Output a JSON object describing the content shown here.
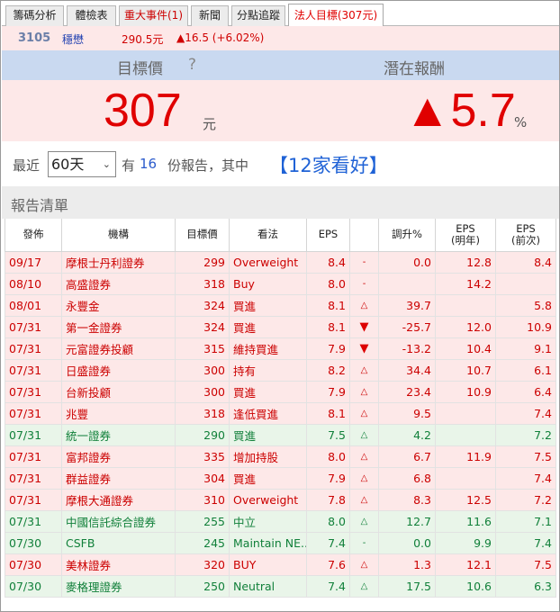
{
  "tabs": [
    {
      "label": "籌碼分析"
    },
    {
      "label": "體檢表"
    },
    {
      "label": "重大事件(1)"
    },
    {
      "label": "新聞"
    },
    {
      "label": "分點追蹤"
    },
    {
      "label": "法人目標(307元)"
    }
  ],
  "stock": {
    "code": "3105",
    "name": "穩懋",
    "price": "290.5元",
    "change": "▲16.5 (+6.02%)"
  },
  "banner": {
    "target_label": "目標價",
    "help_icon": "?",
    "return_label": "潛在報酬"
  },
  "target": {
    "value": "307",
    "unit": "元",
    "potential": "▲5.7",
    "potential_unit": "%"
  },
  "filter": {
    "prefix": "最近",
    "period": "60天",
    "has": "有",
    "count": "16",
    "suffix": "份報告，其中",
    "highlight": "【12家看好】"
  },
  "list": {
    "title": "報告清單",
    "headers": [
      "發佈",
      "機構",
      "目標價",
      "看法",
      "EPS",
      "",
      "調升%",
      "EPS\n(明年)",
      "EPS\n(前次)"
    ],
    "rows": [
      {
        "tone": "r",
        "date": "09/17",
        "org": "摩根士丹利證券",
        "target": "299",
        "view": "Overweight",
        "eps": "8.4",
        "arrow": "-",
        "chg": "0.0",
        "eps_next": "12.8",
        "eps_prev": "8.4"
      },
      {
        "tone": "r",
        "date": "08/10",
        "org": "高盛證券",
        "target": "318",
        "view": "Buy",
        "eps": "8.0",
        "arrow": "-",
        "chg": "",
        "eps_next": "14.2",
        "eps_prev": ""
      },
      {
        "tone": "r",
        "date": "08/01",
        "org": "永豐金",
        "target": "324",
        "view": "買進",
        "eps": "8.1",
        "arrow": "△",
        "chg": "39.7",
        "eps_next": "",
        "eps_prev": "5.8"
      },
      {
        "tone": "r",
        "date": "07/31",
        "org": "第一金證券",
        "target": "324",
        "view": "買進",
        "eps": "8.1",
        "arrow": "▼",
        "chg": "-25.7",
        "eps_next": "12.0",
        "eps_prev": "10.9"
      },
      {
        "tone": "r",
        "date": "07/31",
        "org": "元富證券投顧",
        "target": "315",
        "view": "維持買進",
        "eps": "7.9",
        "arrow": "▼",
        "chg": "-13.2",
        "eps_next": "10.4",
        "eps_prev": "9.1"
      },
      {
        "tone": "r",
        "date": "07/31",
        "org": "日盛證券",
        "target": "300",
        "view": "持有",
        "eps": "8.2",
        "arrow": "△",
        "chg": "34.4",
        "eps_next": "10.7",
        "eps_prev": "6.1"
      },
      {
        "tone": "r",
        "date": "07/31",
        "org": "台新投顧",
        "target": "300",
        "view": "買進",
        "eps": "7.9",
        "arrow": "△",
        "chg": "23.4",
        "eps_next": "10.9",
        "eps_prev": "6.4"
      },
      {
        "tone": "r",
        "date": "07/31",
        "org": "兆豐",
        "target": "318",
        "view": "逢低買進",
        "eps": "8.1",
        "arrow": "△",
        "chg": "9.5",
        "eps_next": "",
        "eps_prev": "7.4"
      },
      {
        "tone": "g",
        "date": "07/31",
        "org": "統一證券",
        "target": "290",
        "view": "買進",
        "eps": "7.5",
        "arrow": "△",
        "chg": "4.2",
        "eps_next": "",
        "eps_prev": "7.2"
      },
      {
        "tone": "r",
        "date": "07/31",
        "org": "富邦證券",
        "target": "335",
        "view": "增加持股",
        "eps": "8.0",
        "arrow": "△",
        "chg": "6.7",
        "eps_next": "11.9",
        "eps_prev": "7.5"
      },
      {
        "tone": "r",
        "date": "07/31",
        "org": "群益證券",
        "target": "304",
        "view": "買進",
        "eps": "7.9",
        "arrow": "△",
        "chg": "6.8",
        "eps_next": "",
        "eps_prev": "7.4"
      },
      {
        "tone": "r",
        "date": "07/31",
        "org": "摩根大通證券",
        "target": "310",
        "view": "Overweight",
        "eps": "7.8",
        "arrow": "△",
        "chg": "8.3",
        "eps_next": "12.5",
        "eps_prev": "7.2"
      },
      {
        "tone": "g",
        "date": "07/31",
        "org": "中國信託綜合證券",
        "target": "255",
        "view": "中立",
        "eps": "8.0",
        "arrow": "△",
        "chg": "12.7",
        "eps_next": "11.6",
        "eps_prev": "7.1"
      },
      {
        "tone": "g",
        "date": "07/30",
        "org": "CSFB",
        "target": "245",
        "view": "Maintain NE...",
        "eps": "7.4",
        "arrow": "-",
        "chg": "0.0",
        "eps_next": "9.9",
        "eps_prev": "7.4"
      },
      {
        "tone": "r",
        "date": "07/30",
        "org": "美林證券",
        "target": "320",
        "view": "BUY",
        "eps": "7.6",
        "arrow": "△",
        "chg": "1.3",
        "eps_next": "12.1",
        "eps_prev": "7.5"
      },
      {
        "tone": "g",
        "date": "07/30",
        "org": "麥格理證券",
        "target": "250",
        "view": "Neutral",
        "eps": "7.4",
        "arrow": "△",
        "chg": "17.5",
        "eps_next": "10.6",
        "eps_prev": "6.3"
      }
    ]
  },
  "colors": {
    "up_red": "#e00000",
    "row_red_bg": "#fde8e8",
    "row_green_bg": "#e9f5e9",
    "green_text": "#11803a",
    "banner_bg": "#c9d9f0",
    "highlight_blue": "#1f62d6"
  }
}
